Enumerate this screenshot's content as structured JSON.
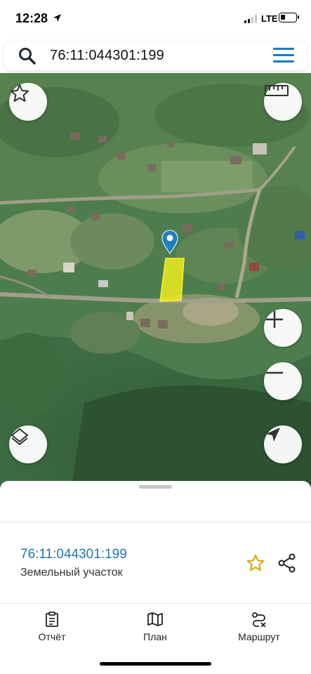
{
  "status_bar": {
    "time": "12:28",
    "network": "LTE",
    "icons": [
      "location-arrow-icon",
      "signal-icon",
      "battery-icon"
    ]
  },
  "search": {
    "query": "76:11:044301:199",
    "icons": [
      "search-icon",
      "menu-icon"
    ],
    "accent_color": "#1a7bc0"
  },
  "map": {
    "type": "satellite",
    "highlight_color": "#ecec1e",
    "marker_color": "#1f7fc2",
    "controls": [
      "favorite-star-icon",
      "ruler-icon",
      "zoom-in-icon",
      "zoom-out-icon",
      "layers-icon",
      "locate-icon"
    ]
  },
  "sheet": {
    "parcel_id": "76:11:044301:199",
    "parcel_type": "Земельный участок",
    "star_color": "#d9a800",
    "actions": [
      "favorite-star-icon",
      "share-icon"
    ]
  },
  "tabs": [
    {
      "label": "Отчёт",
      "icon": "report-icon"
    },
    {
      "label": "План",
      "icon": "map-plan-icon"
    },
    {
      "label": "Маршрут",
      "icon": "route-icon"
    }
  ]
}
